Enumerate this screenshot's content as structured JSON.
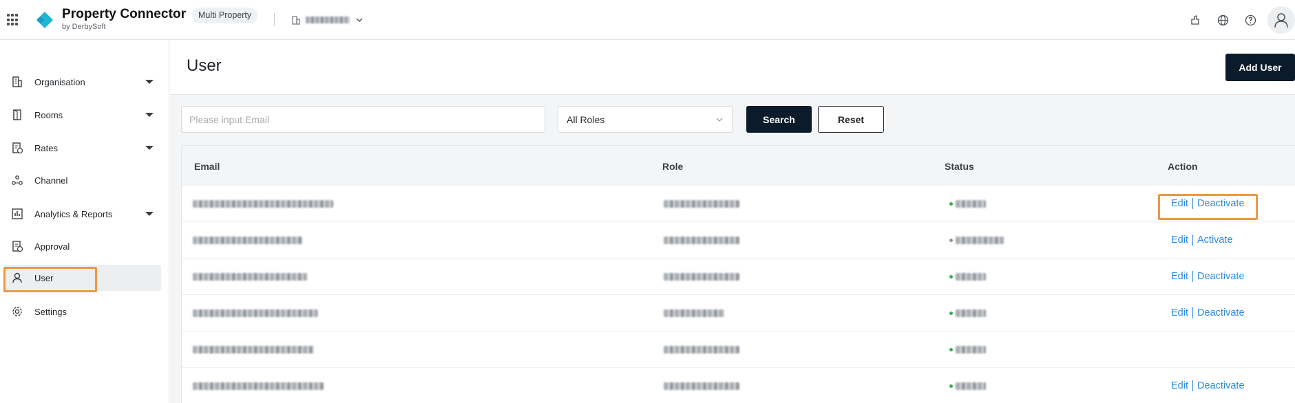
{
  "app": {
    "title": "Property Connector",
    "subtitle": "by DerbySoft",
    "scope_badge": "Multi Property",
    "brand_colors": {
      "primary_dark": "#0b1b2b",
      "logo": "#1fb6d6",
      "link": "#2d8ae0",
      "highlight": "#e89a48"
    }
  },
  "topbar": {
    "icons": [
      "apps-grid-icon",
      "building-icon",
      "chevron-down-icon",
      "notification-icon",
      "globe-icon",
      "help-icon",
      "user-icon"
    ]
  },
  "sidebar": {
    "items": [
      {
        "label": "Organisation",
        "icon": "building-icon",
        "expandable": true,
        "active": false
      },
      {
        "label": "Rooms",
        "icon": "door-icon",
        "expandable": true,
        "active": false
      },
      {
        "label": "Rates",
        "icon": "rates-icon",
        "expandable": true,
        "active": false
      },
      {
        "label": "Channel",
        "icon": "channel-icon",
        "expandable": false,
        "active": false
      },
      {
        "label": "Analytics & Reports",
        "icon": "analytics-icon",
        "expandable": true,
        "active": false
      },
      {
        "label": "Approval",
        "icon": "approval-icon",
        "expandable": false,
        "active": false
      },
      {
        "label": "User",
        "icon": "user-icon",
        "expandable": false,
        "active": true
      },
      {
        "label": "Settings",
        "icon": "gear-icon",
        "expandable": false,
        "active": false
      }
    ]
  },
  "page": {
    "title": "User",
    "add_button": "Add User"
  },
  "filters": {
    "email_placeholder": "Please input Email",
    "role_selected": "All Roles",
    "search_button": "Search",
    "reset_button": "Reset"
  },
  "table": {
    "columns": [
      "Email",
      "Role",
      "Status",
      "Action"
    ],
    "rows": [
      {
        "status_color": "#3aaa55",
        "actions": [
          "Edit",
          "Deactivate"
        ]
      },
      {
        "status_color": "#8c9299",
        "actions": [
          "Edit",
          "Activate"
        ]
      },
      {
        "status_color": "#3aaa55",
        "actions": [
          "Edit",
          "Deactivate"
        ]
      },
      {
        "status_color": "#3aaa55",
        "actions": [
          "Edit",
          "Deactivate"
        ]
      },
      {
        "status_color": "#3aaa55",
        "actions": []
      },
      {
        "status_color": "#3aaa55",
        "actions": [
          "Edit",
          "Deactivate"
        ]
      }
    ]
  }
}
